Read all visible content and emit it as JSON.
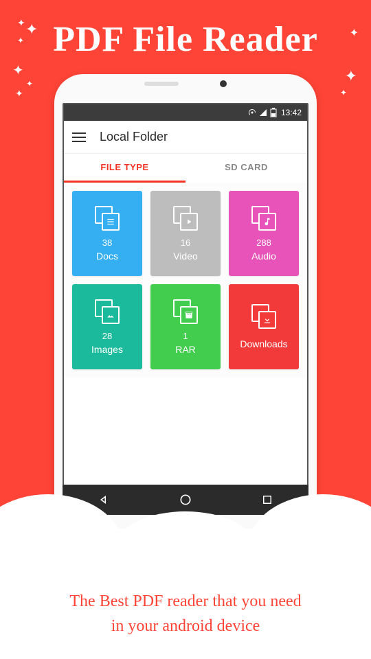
{
  "hero": {
    "title": "PDF File Reader"
  },
  "statusbar": {
    "time": "13:42"
  },
  "appbar": {
    "title": "Local Folder"
  },
  "tabs": {
    "file_type": "FILE TYPE",
    "sd_card": "SD CARD"
  },
  "tiles": {
    "docs": {
      "count": "38",
      "label": "Docs"
    },
    "video": {
      "count": "16",
      "label": "Video"
    },
    "audio": {
      "count": "288",
      "label": "Audio"
    },
    "images": {
      "count": "28",
      "label": "Images"
    },
    "rar": {
      "count": "1",
      "label": "RAR"
    },
    "downloads": {
      "count": "",
      "label": "Downloads"
    }
  },
  "footer": {
    "line1": "The Best PDF reader that you need",
    "line2": "in your android device"
  }
}
